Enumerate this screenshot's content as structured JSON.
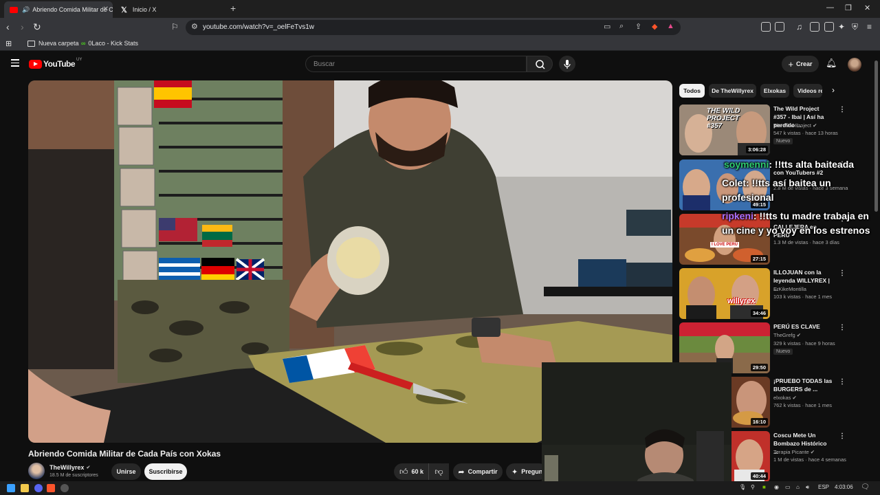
{
  "browser": {
    "tabs": [
      {
        "label": "Abriendo Comida Militar de C",
        "active": true
      },
      {
        "label": "Inicio / X",
        "active": false
      }
    ],
    "url": "youtube.com/watch?v=_oelFeTvs1w",
    "bookmarks": [
      "Nueva carpeta",
      "0Laco - Kick Stats"
    ]
  },
  "youtube": {
    "logo_text": "YouTube",
    "region": "UY",
    "search_placeholder": "Buscar",
    "create_label": "Crear"
  },
  "video": {
    "title": "Abriendo Comida Militar de Cada País con Xokas",
    "channel": "TheWillyrex",
    "subscribers": "18.5 M de suscriptores",
    "join_label": "Unirse",
    "subscribe_label": "Suscribirse",
    "likes": "60 k",
    "share_label": "Compartir",
    "ask_label": "Pregunt"
  },
  "chips": [
    "Todos",
    "De TheWillyrex",
    "Elxokas",
    "Videos re"
  ],
  "recommendations": [
    {
      "title": "The Wild Project #357 - Ibai | Así ha perdido ...",
      "channel": "The Wild Project",
      "meta": "547 k vistas · hace 13 horas",
      "badge": "Nuevo",
      "duration": "3:06:28"
    },
    {
      "title": "con YouTubers #2",
      "channel": "",
      "meta": "2.8 M de vistas · hace 3 semana",
      "badge": "",
      "duration": "49:15"
    },
    {
      "title": "CALLEJERA en PERÚ",
      "channel": "",
      "meta": "1.3 M de vistas · hace 3 días",
      "badge": "",
      "duration": "27:15"
    },
    {
      "title": "ILLOJUAN con la leyenda WILLYREX | ...",
      "channel": "ErKikeMontilla",
      "meta": "103 k vistas · hace 1 mes",
      "badge": "",
      "duration": "34:46"
    },
    {
      "title": "PERÚ ES CLAVE",
      "channel": "TheGrefg",
      "meta": "329 k vistas · hace 9 horas",
      "badge": "Nuevo",
      "duration": "29:50"
    },
    {
      "title": "¡PRUEBO TODAS las BURGERS de ...",
      "channel": "elxokas",
      "meta": "762 k vistas · hace 1 mes",
      "badge": "",
      "duration": "16:10"
    },
    {
      "title": "Coscu Mete Un Bombazo Histórico ...",
      "channel": "Terapia Picante",
      "meta": "1 M de vistas · hace 4 semanas",
      "badge": "",
      "duration": "40:44"
    }
  ],
  "chat": [
    {
      "user": "soymenni",
      "text": ": !!tts alta baiteada",
      "color": "#2ecc71"
    },
    {
      "user": "Colet",
      "text": ": !!tts así baitea un profesional",
      "color": "#ffffff"
    },
    {
      "user": "ripkeni",
      "text": ": !!tts tu madre trabaja en un cine y yo voy en los estrenos",
      "color": "#a970ff"
    }
  ],
  "overlay_thumb_text": {
    "thumb1": "THE WILD PROJECT #357",
    "thumb3": "I LOVE PERÚ",
    "thumb4": "willyrex"
  },
  "taskbar": {
    "lang": "ESP",
    "time": "4:03:06"
  },
  "colors": {
    "accent_red": "#ff0000",
    "bg": "#0f0f0f",
    "surface": "#272727"
  }
}
